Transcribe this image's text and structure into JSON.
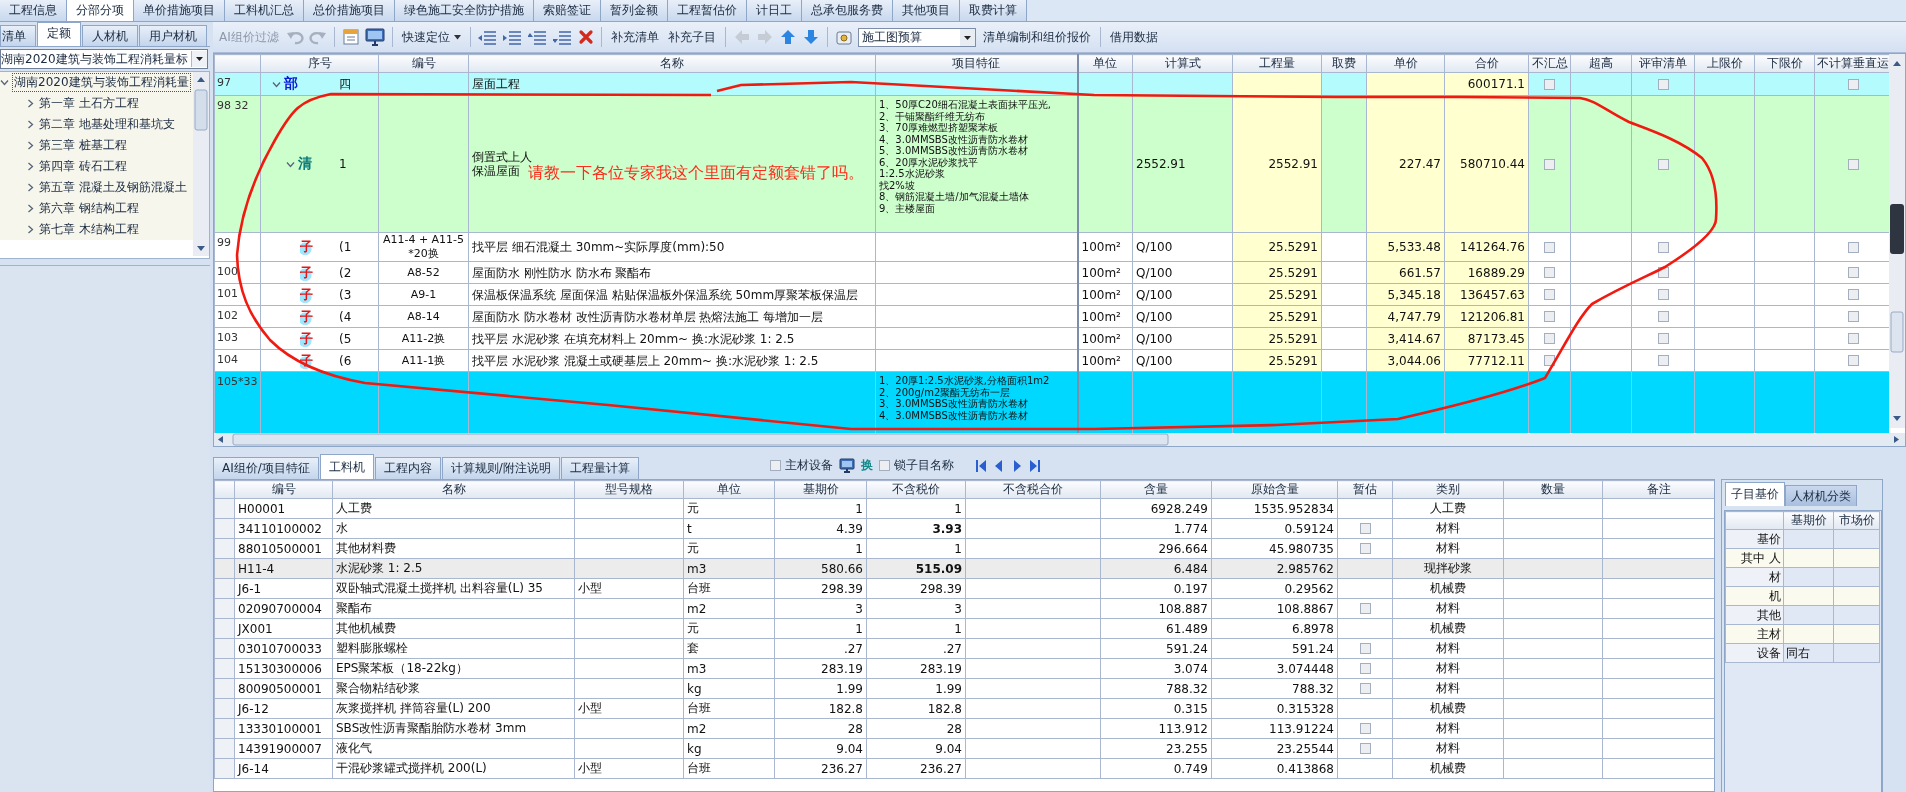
{
  "top_tabs": [
    {
      "label": "工程信息",
      "selected": false
    },
    {
      "label": "分部分项",
      "selected": true
    },
    {
      "label": "单价措施项目",
      "selected": false
    },
    {
      "label": "工料机汇总",
      "selected": false
    },
    {
      "label": "总价措施项目",
      "selected": false
    },
    {
      "label": "绿色施工安全防护措施",
      "selected": false
    },
    {
      "label": "索赔签证",
      "selected": false
    },
    {
      "label": "暂列金额",
      "selected": false
    },
    {
      "label": "工程暂估价",
      "selected": false
    },
    {
      "label": "计日工",
      "selected": false
    },
    {
      "label": "总承包服务费",
      "selected": false
    },
    {
      "label": "其他项目",
      "selected": false
    },
    {
      "label": "取费计算",
      "selected": false
    }
  ],
  "left_panel": {
    "tabs": [
      {
        "label": "清单",
        "selected": false
      },
      {
        "label": "定额",
        "selected": true
      },
      {
        "label": "人材机",
        "selected": false
      },
      {
        "label": "用户材机",
        "selected": false
      }
    ],
    "library": "湖南2020建筑与装饰工程消耗量标",
    "tree": [
      {
        "label": "湖南2020建筑与装饰工程消耗量",
        "expanded": true,
        "children": [
          {
            "label": "第一章 土石方工程",
            "expanded": false
          },
          {
            "label": "第二章 地基处理和基坑支",
            "expanded": false
          },
          {
            "label": "第三章 桩基工程",
            "expanded": false
          },
          {
            "label": "第四章 砖石工程",
            "expanded": false
          },
          {
            "label": "第五章 混凝土及钢筋混凝土",
            "expanded": false
          },
          {
            "label": "第六章 钢结构工程",
            "expanded": false
          },
          {
            "label": "第七章 木结构工程",
            "expanded": false
          }
        ]
      }
    ]
  },
  "toolbar": {
    "ai_filter": {
      "label": "AI组价过滤",
      "disabled": true
    },
    "quick_locate": "快速定位",
    "buttons": [
      "补充清单",
      "补充子目"
    ],
    "mode": "施工图预算",
    "actions": [
      "清单编制和组价报价",
      "借用数据"
    ]
  },
  "grid": {
    "columns": [
      "序号",
      "编号",
      "名称",
      "项目特征",
      "单位",
      "计算式",
      "工程量",
      "取费",
      "单价",
      "合价",
      "不汇总",
      "超高",
      "评审清单",
      "上限价",
      "下限价",
      "不计算垂直运"
    ],
    "rows": [
      {
        "row": "97",
        "kind": "part",
        "expanded": true,
        "badge": "部",
        "seq": "四",
        "name": "屋面工程",
        "total": "600171.1",
        "not_summarized": false,
        "reviewed": false,
        "no_vertical": false,
        "selected": false
      },
      {
        "row": "98 32",
        "kind": "list",
        "expanded": true,
        "badge": "清",
        "seq": "1",
        "name": "倒置式上人保温屋面",
        "features": [
          "1、50厚C20细石混凝土表面抹平压光,",
          "2、干铺聚酯纤维无纺布",
          "3、70厚难燃型挤塑聚苯板",
          "4、3.0MMSBS改性沥青防水卷材",
          "5、3.0MMSBS改性沥青防水卷材",
          "6、20厚水泥砂浆找平",
          "1:2.5水泥砂浆",
          "找2%坡",
          "8、钢筋混凝土墙/加气混凝土墙体",
          "9、主楼屋面"
        ],
        "formula": "2552.91",
        "quantity": "2552.91",
        "unit_price": "227.47",
        "total": "580710.44",
        "not_summarized": false,
        "reviewed": false,
        "no_vertical": false,
        "selected": false
      },
      {
        "row": "99",
        "kind": "sub",
        "badge": "子",
        "seq": "(1",
        "code": "A11-4 + A11-5\n*20换",
        "name": "找平层 细石混凝土 30mm~实际厚度(mm):50",
        "unit": "100m²",
        "formula": "Q/100",
        "quantity": "25.5291",
        "unit_price": "5,533.48",
        "total": "141264.76",
        "not_summarized": false,
        "reviewed": false,
        "no_vertical": false,
        "selected": false
      },
      {
        "row": "100",
        "kind": "sub",
        "badge": "子",
        "seq": "(2",
        "code": "A8-52",
        "name": "屋面防水 刚性防水 防水布 聚酯布",
        "unit": "100m²",
        "formula": "Q/100",
        "quantity": "25.5291",
        "unit_price": "661.57",
        "total": "16889.29",
        "not_summarized": false,
        "reviewed": false,
        "no_vertical": false,
        "selected": false
      },
      {
        "row": "101",
        "kind": "sub",
        "badge": "子",
        "seq": "(3",
        "code": "A9-1",
        "name": "保温板保温系统 屋面保温 粘贴保温板外保温系统 50mm厚聚苯板保温层",
        "unit": "100m²",
        "formula": "Q/100",
        "quantity": "25.5291",
        "unit_price": "5,345.18",
        "total": "136457.63",
        "not_summarized": false,
        "reviewed": false,
        "no_vertical": false,
        "selected": false
      },
      {
        "row": "102",
        "kind": "sub",
        "badge": "子",
        "seq": "(4",
        "code": "A8-14",
        "name": "屋面防水 防水卷材 改性沥青防水卷材单层 热熔法施工 每增加一层",
        "unit": "100m²",
        "formula": "Q/100",
        "quantity": "25.5291",
        "unit_price": "4,747.79",
        "total": "121206.81",
        "not_summarized": false,
        "reviewed": false,
        "no_vertical": false,
        "selected": false
      },
      {
        "row": "103",
        "kind": "sub",
        "badge": "子",
        "seq": "(5",
        "code": "A11-2换",
        "name": "找平层 水泥砂浆 在填充材料上 20mm~ 换:水泥砂浆 1: 2.5",
        "unit": "100m²",
        "formula": "Q/100",
        "quantity": "25.5291",
        "unit_price": "3,414.67",
        "total": "87173.45",
        "not_summarized": false,
        "reviewed": false,
        "no_vertical": false,
        "selected": false
      },
      {
        "row": "104",
        "kind": "sub",
        "badge": "子",
        "seq": "(6",
        "code": "A11-1换",
        "name": "找平层 水泥砂浆 混凝土或硬基层上 20mm~ 换:水泥砂浆 1: 2.5",
        "unit": "100m²",
        "formula": "Q/100",
        "quantity": "25.5291",
        "unit_price": "3,044.06",
        "total": "77712.11",
        "not_summarized": false,
        "reviewed": false,
        "no_vertical": false,
        "selected": false
      },
      {
        "row": "105*33",
        "kind": "list",
        "features": [
          "1、20厚1:2.5水泥砂浆,分格面积1m2",
          "2、200g/m2聚酯无纺布一层",
          "3、3.0MMSBS改性沥青防水卷材",
          "4、3.0MMSBS改性沥青防水卷材"
        ],
        "selected": true
      }
    ]
  },
  "detail": {
    "tabs": [
      {
        "label": "AI组价/项目特征",
        "selected": false
      },
      {
        "label": "工料机",
        "selected": true
      },
      {
        "label": "工程内容",
        "selected": false
      },
      {
        "label": "计算规则/附注说明",
        "selected": false
      },
      {
        "label": "工程量计算",
        "selected": false
      }
    ],
    "options": [
      {
        "kind": "checkbox",
        "label": "主材设备",
        "checked": false
      },
      {
        "kind": "swap",
        "label": "换"
      },
      {
        "kind": "checkbox",
        "label": "锁子目名称",
        "checked": false
      }
    ],
    "columns": [
      "编号",
      "名称",
      "型号规格",
      "单位",
      "基期价",
      "不含税价",
      "不含税合价",
      "含量",
      "原始含量",
      "暂估",
      "类别",
      "数量",
      "备注"
    ],
    "rows": [
      {
        "code": "H00001",
        "name": "人工费",
        "unit": "元",
        "base_price": "1",
        "price": "1",
        "price_changed": false,
        "content": "6928.249",
        "original_content": "1535.952834",
        "category": "人工费",
        "selected": false
      },
      {
        "code": "34110100002",
        "name": "水",
        "unit": "t",
        "base_price": "4.39",
        "price": "3.93",
        "price_changed": true,
        "content": "1.774",
        "original_content": "0.59124",
        "estimate": false,
        "category": "材料",
        "selected": false
      },
      {
        "code": "88010500001",
        "name": "其他材料费",
        "unit": "元",
        "base_price": "1",
        "price": "1",
        "price_changed": false,
        "content": "296.664",
        "original_content": "45.980735",
        "estimate": false,
        "category": "材料",
        "selected": false
      },
      {
        "code": "H11-4",
        "name": "水泥砂浆 1: 2.5",
        "unit": "m3",
        "base_price": "580.66",
        "price": "515.09",
        "price_changed": true,
        "content": "6.484",
        "original_content": "2.985762",
        "category": "现拌砂浆",
        "selected": true
      },
      {
        "code": "J6-1",
        "name": "双卧轴式混凝土搅拌机 出料容量(L) 35",
        "spec": "小型",
        "unit": "台班",
        "base_price": "298.39",
        "price": "298.39",
        "price_changed": false,
        "content": "0.197",
        "original_content": "0.29562",
        "category": "机械费",
        "selected": false
      },
      {
        "code": "02090700004",
        "name": "聚酯布",
        "unit": "m2",
        "base_price": "3",
        "price": "3",
        "price_changed": false,
        "content": "108.887",
        "original_content": "108.8867",
        "estimate": false,
        "category": "材料",
        "selected": false
      },
      {
        "code": "JX001",
        "name": "其他机械费",
        "unit": "元",
        "base_price": "1",
        "price": "1",
        "price_changed": false,
        "content": "61.489",
        "original_content": "6.8978",
        "category": "机械费",
        "selected": false
      },
      {
        "code": "03010700033",
        "name": "塑料膨胀螺栓",
        "unit": "套",
        "base_price": ".27",
        "price": ".27",
        "price_changed": false,
        "content": "591.24",
        "original_content": "591.24",
        "estimate": false,
        "category": "材料",
        "selected": false
      },
      {
        "code": "15130300006",
        "name": "EPS聚苯板（18-22kg）",
        "unit": "m3",
        "base_price": "283.19",
        "price": "283.19",
        "price_changed": false,
        "content": "3.074",
        "original_content": "3.074448",
        "estimate": false,
        "category": "材料",
        "selected": false
      },
      {
        "code": "80090500001",
        "name": "聚合物粘结砂浆",
        "unit": "kg",
        "base_price": "1.99",
        "price": "1.99",
        "price_changed": false,
        "content": "788.32",
        "original_content": "788.32",
        "estimate": false,
        "category": "材料",
        "selected": false
      },
      {
        "code": "J6-12",
        "name": "灰浆搅拌机 拌筒容量(L) 200",
        "spec": "小型",
        "unit": "台班",
        "base_price": "182.8",
        "price": "182.8",
        "price_changed": false,
        "content": "0.315",
        "original_content": "0.315328",
        "category": "机械费",
        "selected": false
      },
      {
        "code": "13330100001",
        "name": "SBS改性沥青聚酯胎防水卷材 3mm",
        "unit": "m2",
        "base_price": "28",
        "price": "28",
        "price_changed": false,
        "content": "113.912",
        "original_content": "113.91224",
        "estimate": false,
        "category": "材料",
        "selected": false
      },
      {
        "code": "14391900007",
        "name": "液化气",
        "unit": "kg",
        "base_price": "9.04",
        "price": "9.04",
        "price_changed": false,
        "content": "23.255",
        "original_content": "23.25544",
        "estimate": false,
        "category": "材料",
        "selected": false
      },
      {
        "code": "J6-14",
        "name": "干混砂浆罐式搅拌机 200(L)",
        "spec": "小型",
        "unit": "台班",
        "base_price": "236.27",
        "price": "236.27",
        "price_changed": false,
        "content": "0.749",
        "original_content": "0.413868",
        "category": "机械费",
        "selected": false
      }
    ]
  },
  "side_panel": {
    "tabs": [
      {
        "label": "子目基价",
        "selected": true
      },
      {
        "label": "人材机分类",
        "selected": false
      }
    ],
    "columns": [
      "基期价",
      "市场价"
    ],
    "rows": [
      {
        "label": "基价"
      },
      {
        "label": "其中 人"
      },
      {
        "label": "材"
      },
      {
        "label": "机"
      },
      {
        "label": "其他"
      },
      {
        "label": "主材"
      },
      {
        "label": "设备",
        "base": "同右"
      }
    ]
  },
  "annotation": {
    "text": "请教一下各位专家我这个里面有定额套错了吗。"
  }
}
